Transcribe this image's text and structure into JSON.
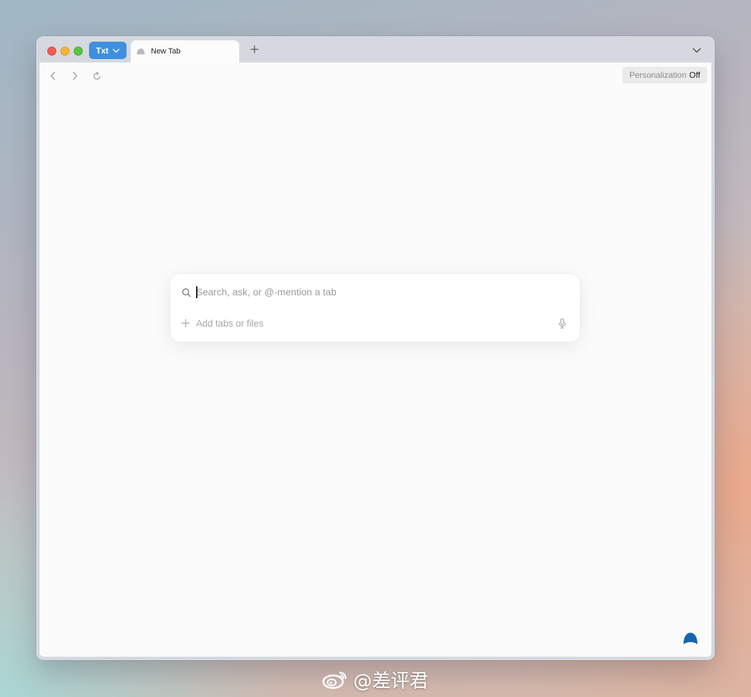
{
  "window": {
    "extension_label": "Txt",
    "tabs": [
      {
        "title": "New Tab",
        "favicon": "new-tab-favicon"
      }
    ],
    "new_tab_icon": "plus-icon",
    "tab_list_icon": "chevron-down-icon",
    "traffic_lights": {
      "close": "#ed5b57",
      "minimize": "#f3b536",
      "maximize": "#5dc442"
    }
  },
  "toolbar": {
    "back_icon": "chevron-left-icon",
    "forward_icon": "chevron-right-icon",
    "reload_icon": "reload-icon",
    "personalization": {
      "label": "Personalization",
      "state": "Off"
    }
  },
  "search": {
    "placeholder": "Search, ask, or @-mention a tab",
    "value": "",
    "add_label": "Add tabs or files",
    "search_icon": "search-icon",
    "add_icon": "plus-icon",
    "mic_icon": "microphone-icon"
  },
  "assistant": {
    "icon": "assistant-icon",
    "color": "#1466ad"
  },
  "colors": {
    "accent": "#3f8fe0",
    "content_bg": "#fbfbfb",
    "chrome_bg": "#d5d9df"
  },
  "watermark": {
    "text": "@差评君"
  }
}
